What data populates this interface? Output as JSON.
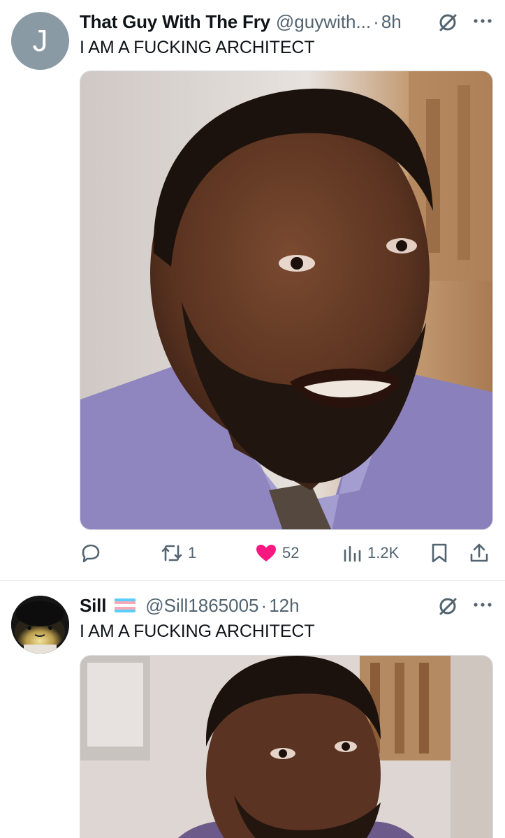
{
  "tweets": [
    {
      "display_name": "That Guy With The Fry",
      "handle": "@guywith...",
      "separator": "·",
      "time": "8h",
      "avatar_letter": "J",
      "text": "I AM A FUCKING ARCHITECT",
      "media_alt": "photo",
      "actions": {
        "reply_count": "",
        "retweet_count": "1",
        "like_count": "52",
        "views_count": "1.2K"
      },
      "liked": true
    },
    {
      "display_name": "Sill",
      "handle": "@Sill1865005",
      "separator": "·",
      "time": "12h",
      "text": "I AM A FUCKING ARCHITECT",
      "media_alt": "photo"
    }
  ],
  "colors": {
    "like_active": "#f91880",
    "secondary_text": "#536471",
    "primary_text": "#0f1419"
  },
  "icons": [
    "reply-icon",
    "retweet-icon",
    "heart-icon",
    "views-icon",
    "bookmark-icon",
    "share-icon",
    "muted-icon",
    "more-icon"
  ]
}
